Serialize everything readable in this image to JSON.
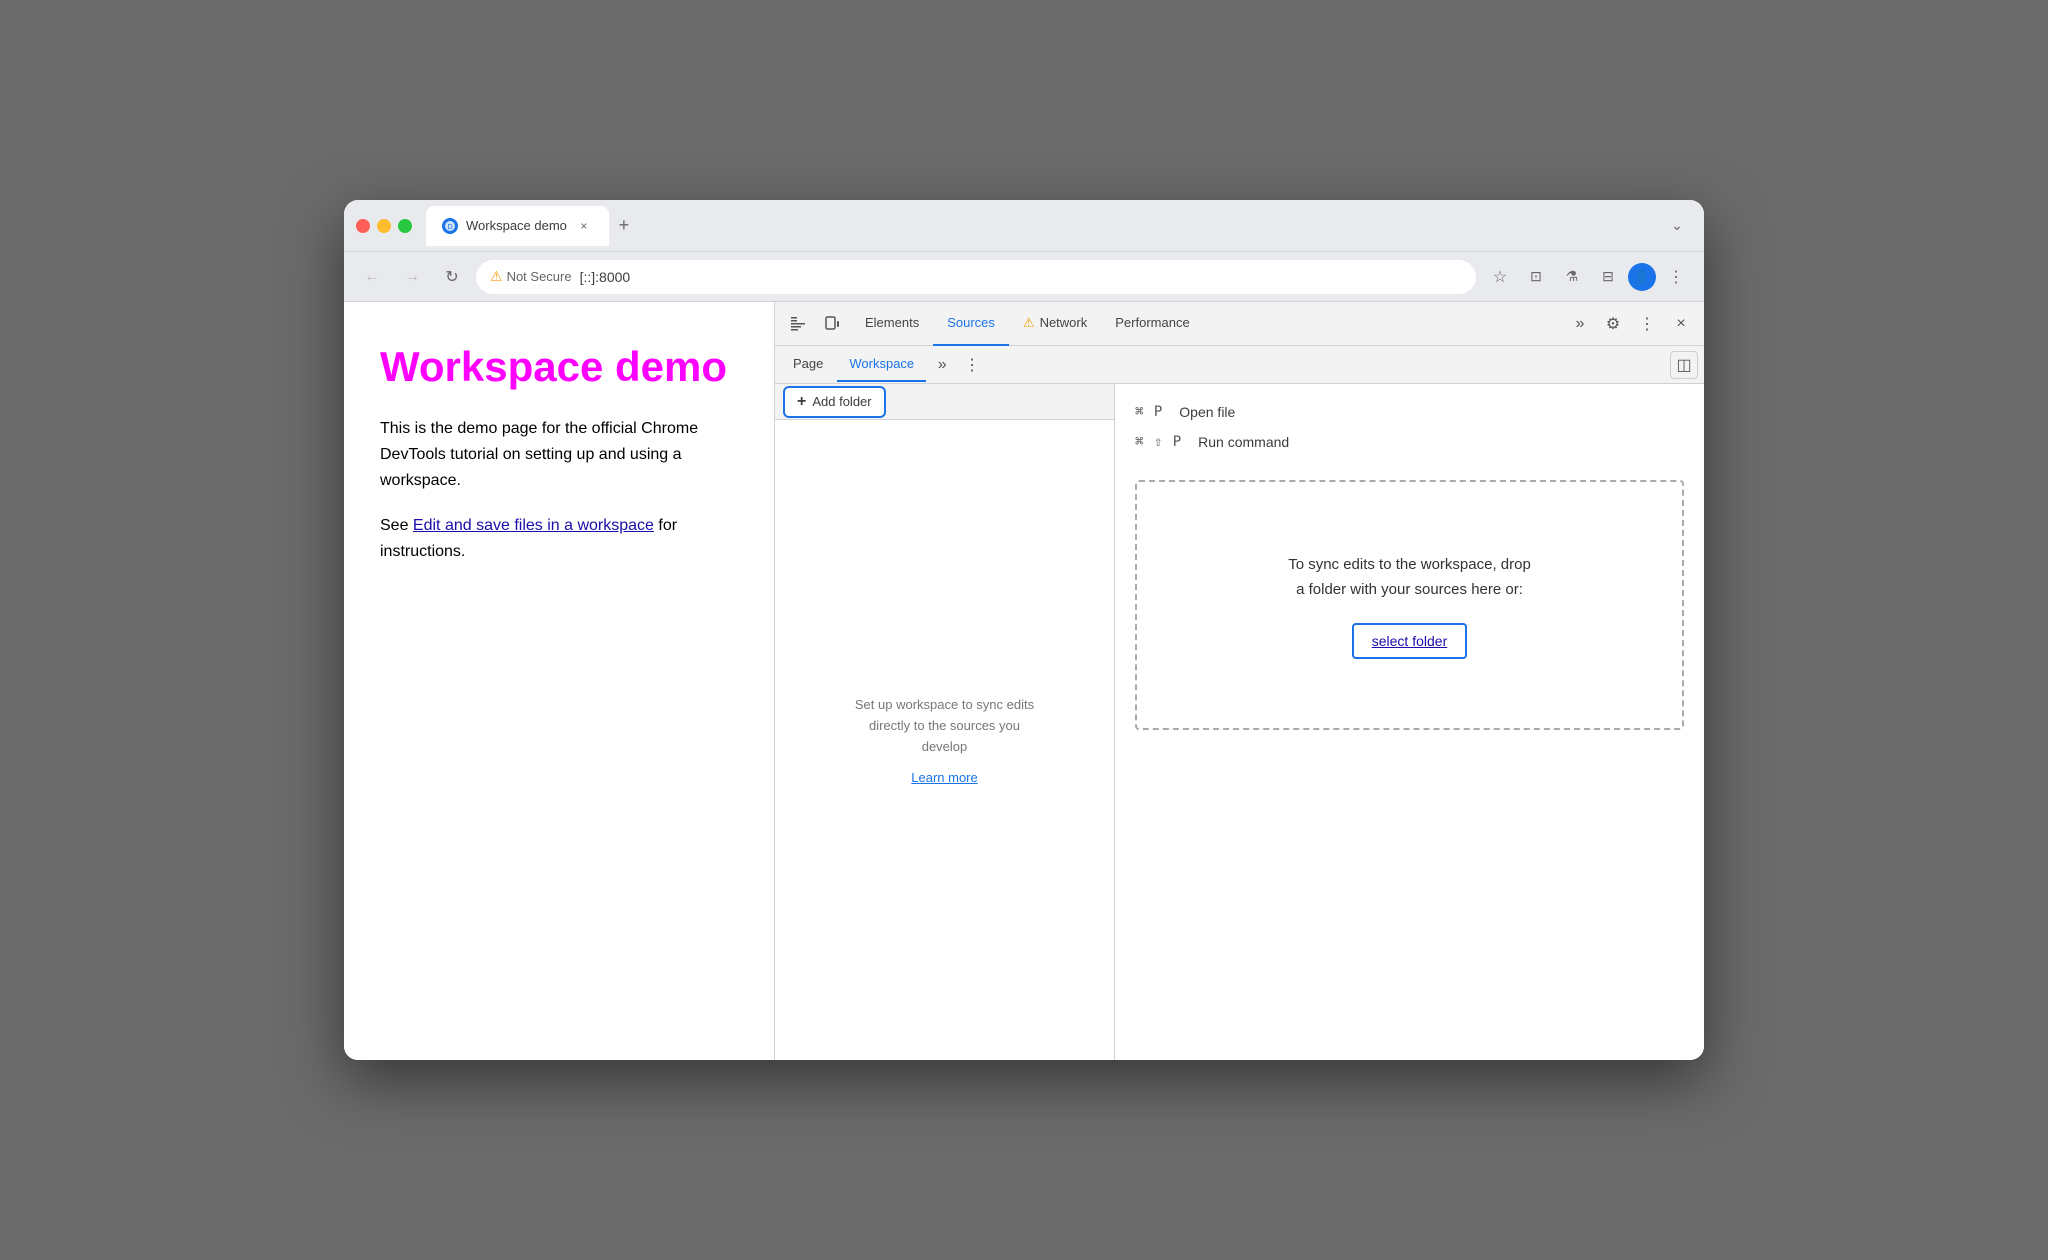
{
  "browser": {
    "tab": {
      "title": "Workspace demo",
      "favicon": "🔵",
      "close": "×",
      "new_tab": "+"
    },
    "nav": {
      "back": "←",
      "forward": "→",
      "reload": "↻",
      "not_secure_label": "Not Secure",
      "url": "[::]:8000",
      "bookmark": "☆",
      "extensions": "⊡",
      "labs": "⚗",
      "split": "⊟",
      "profile": "👤",
      "menu": "⋮",
      "chevron": "⌄"
    }
  },
  "page": {
    "title": "Workspace demo",
    "desc": "This is the demo page for the official Chrome DevTools tutorial on setting up and using a workspace.",
    "see_text": "See",
    "link_text": "Edit and save files in a workspace",
    "instructions_text": "for instructions."
  },
  "devtools": {
    "toolbar": {
      "inspect_icon": "⊹",
      "device_icon": "⊡",
      "tabs": [
        {
          "label": "Elements",
          "active": false
        },
        {
          "label": "Sources",
          "active": true
        },
        {
          "label": "Network",
          "active": false,
          "warning": true
        },
        {
          "label": "Performance",
          "active": false
        }
      ],
      "more": "»",
      "settings_icon": "⚙",
      "dots_icon": "⋮",
      "close_icon": "×",
      "panel_right_icon": "⊡"
    },
    "sub_toolbar": {
      "tabs": [
        {
          "label": "Page",
          "active": false
        },
        {
          "label": "Workspace",
          "active": true
        }
      ],
      "more": "»",
      "dots": "⋮",
      "panel_toggle": "◫"
    },
    "left_panel": {
      "add_folder_label": "+ Add folder",
      "plus": "+",
      "add_folder_text": "Add folder",
      "workspace_hint": "Set up workspace to sync edits directly to the sources you develop",
      "learn_more": "Learn more"
    },
    "right_panel": {
      "shortcut1_keys": "⌘ P",
      "shortcut1_action": "Open file",
      "shortcut2_keys": "⌘ ⇧ P",
      "shortcut2_action": "Run command",
      "drop_zone_line1": "To sync edits to the workspace, drop",
      "drop_zone_line2": "a folder with your sources here or:",
      "select_folder": "select folder"
    }
  }
}
